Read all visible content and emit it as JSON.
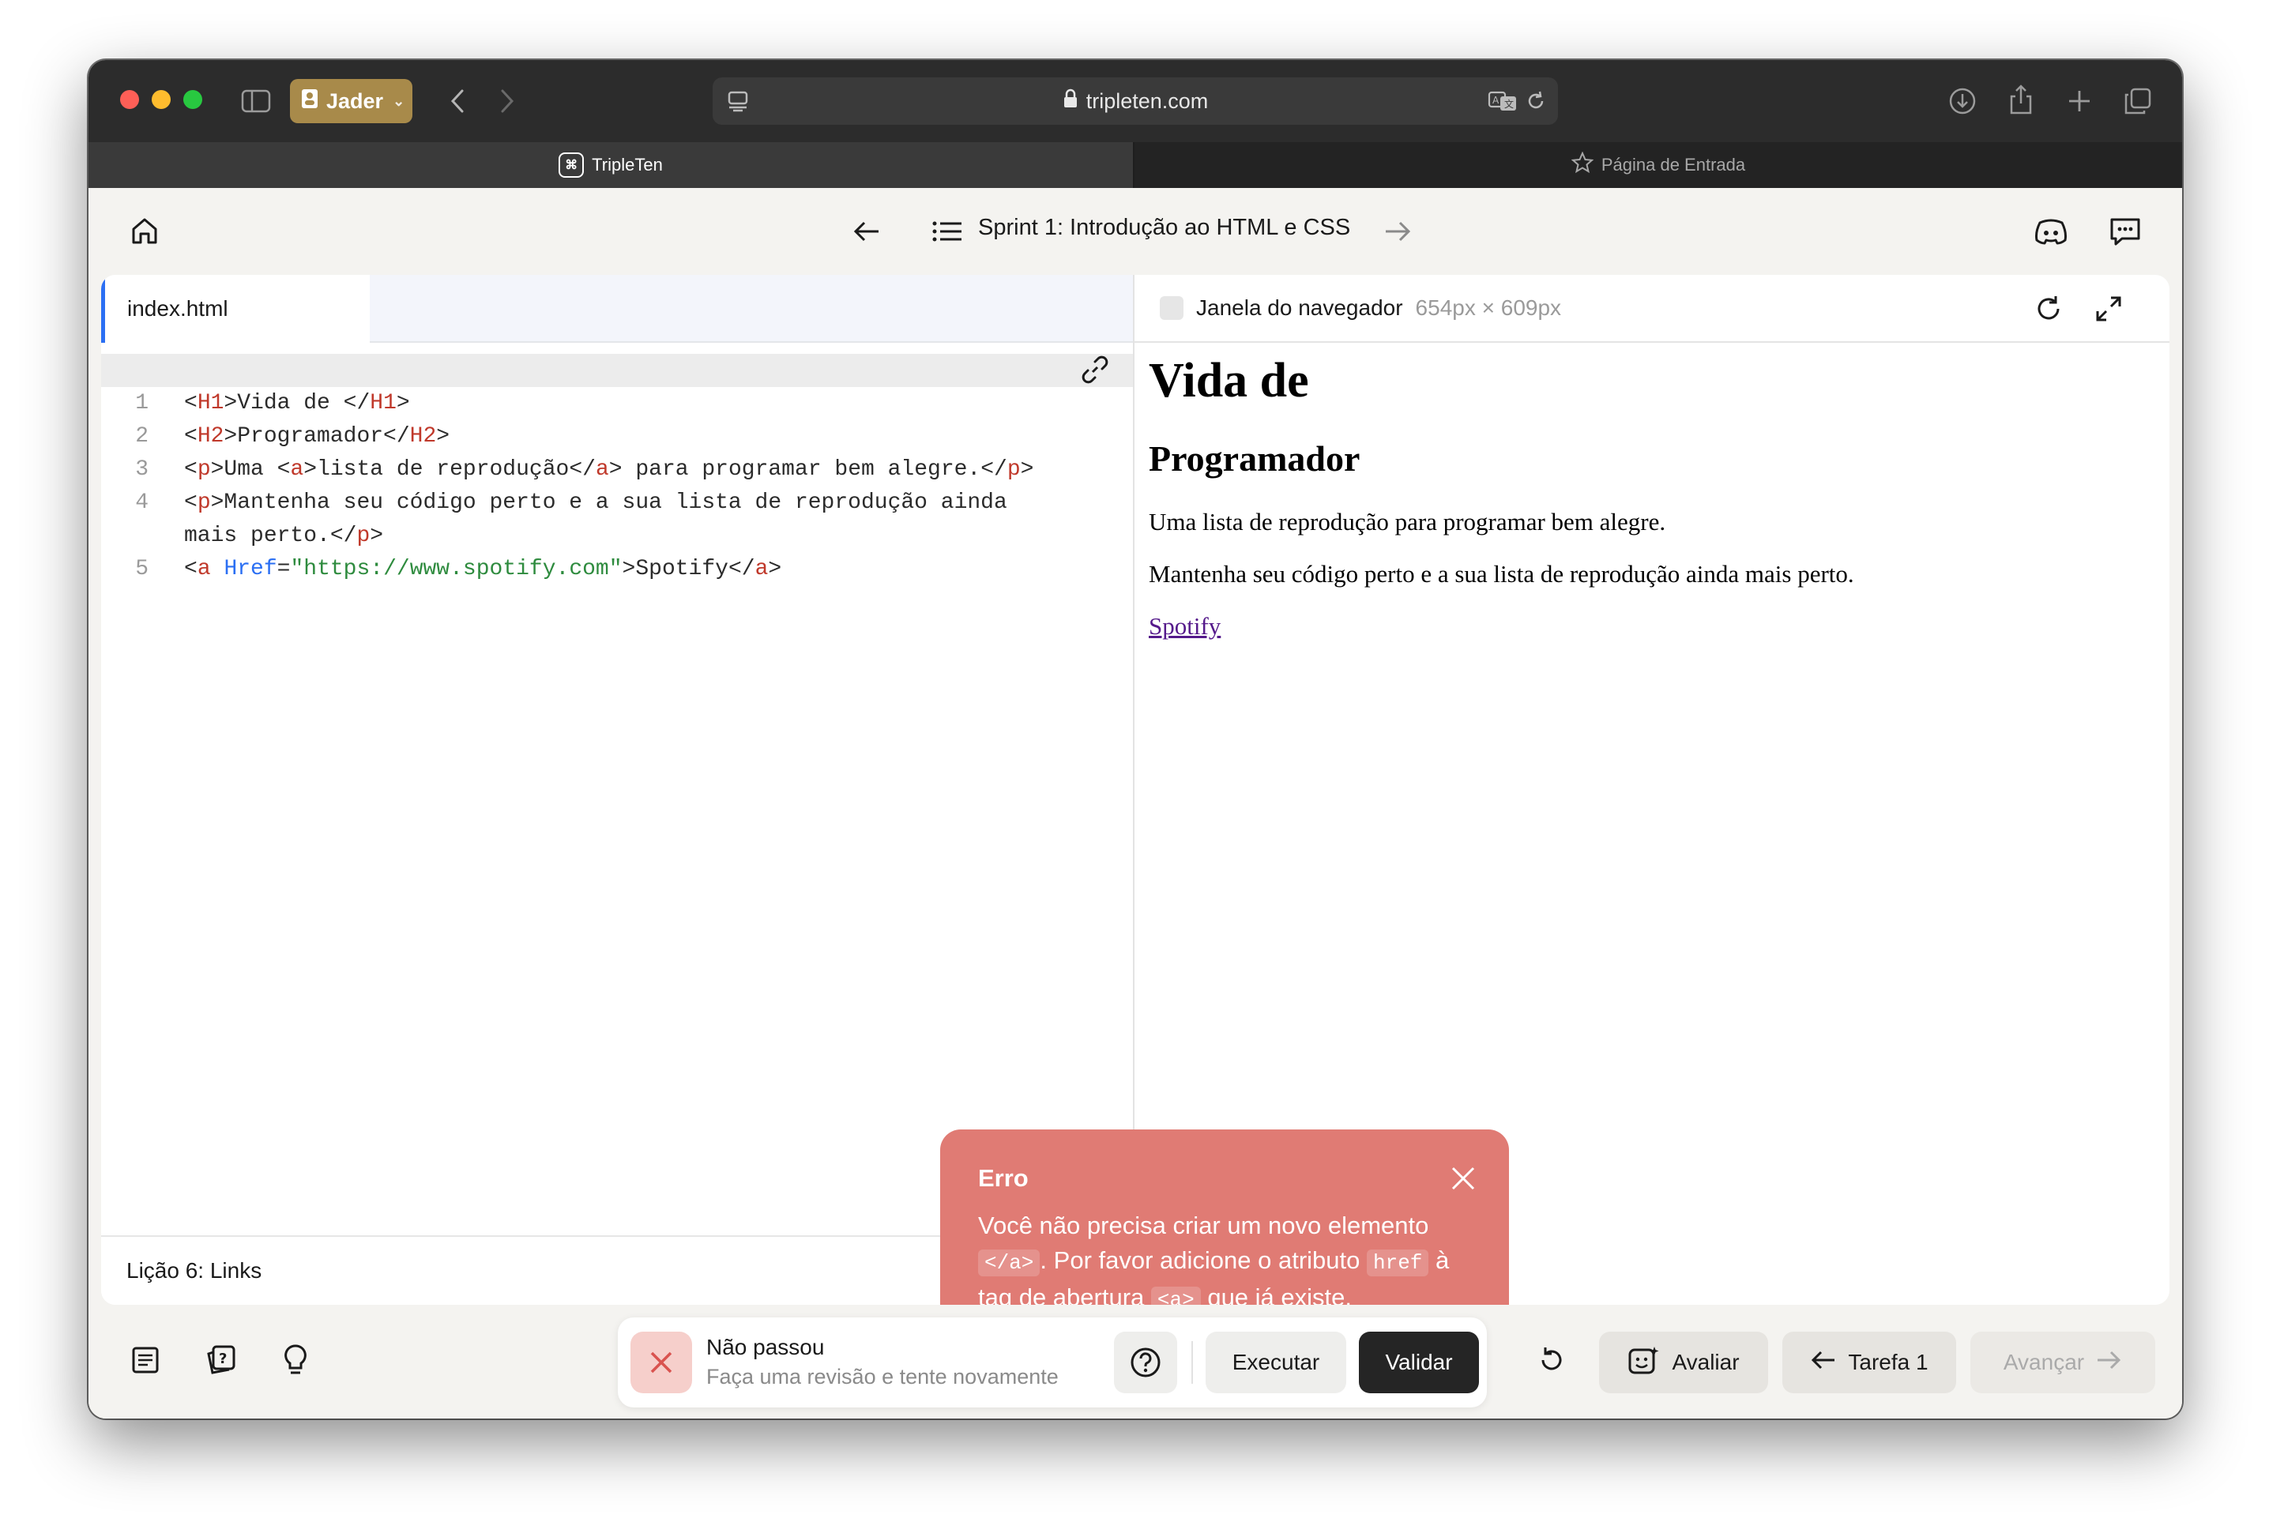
{
  "browser": {
    "profile_name": "Jader",
    "url": "tripleten.com",
    "tabs": [
      {
        "label": "TripleTen",
        "logo": "⌘"
      },
      {
        "label": "Página de Entrada"
      }
    ]
  },
  "header": {
    "sprint_title": "Sprint 1: Introdução ao HTML e CSS"
  },
  "editor": {
    "file_tab": "index.html",
    "lesson": "Lição 6: Links",
    "line_numbers": [
      "1",
      "2",
      "3",
      "4",
      "",
      "5"
    ]
  },
  "preview": {
    "title": "Janela do navegador",
    "size": "654px × 609px",
    "h1": "Vida de",
    "h2": "Programador",
    "p1": "Uma lista de reprodução para programar bem alegre.",
    "p2": "Mantenha seu código perto e a sua lista de reprodução ainda mais perto.",
    "link": "Spotify"
  },
  "toast": {
    "title": "Erro",
    "msg_1": "Você não precisa criar um novo elemento",
    "code_1": "</a>",
    "msg_2": ". Por favor adicione o atributo",
    "code_2": "href",
    "msg_3": "à tag de abertura",
    "code_3": "<a>",
    "msg_4": "que já existe."
  },
  "bottom": {
    "status_title": "Não passou",
    "status_sub": "Faça uma revisão e tente novamente",
    "run_label": "Executar",
    "validate_label": "Validar",
    "review_label": "Avaliar",
    "prev_label": "Tarefa 1",
    "next_label": "Avançar"
  },
  "colors": {
    "accent_blue": "#2b6ff3",
    "error_red": "#e07b74",
    "tag_red": "#c0392b",
    "string_green": "#2e8b3e"
  }
}
